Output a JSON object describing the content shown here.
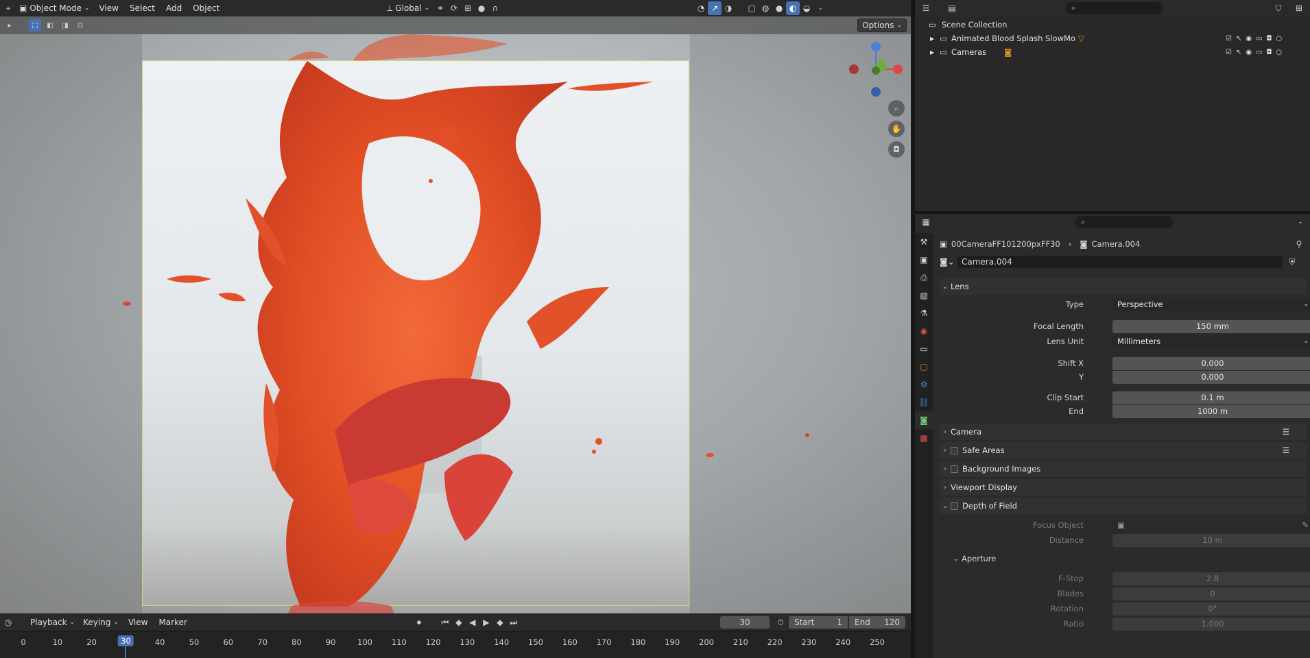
{
  "header": {
    "mode": "Object Mode",
    "menus": [
      "View",
      "Select",
      "Add",
      "Object"
    ],
    "orientation": "Global",
    "options_label": "Options"
  },
  "outliner": {
    "root": "Scene Collection",
    "items": [
      {
        "label": "Animated Blood Splash SlowMo"
      },
      {
        "label": "Cameras"
      }
    ]
  },
  "properties": {
    "breadcrumb_object": "00CameraFF101200pxFF30",
    "breadcrumb_data": "Camera.004",
    "datablock_name": "Camera.004",
    "lens": {
      "title": "Lens",
      "type_label": "Type",
      "type_value": "Perspective",
      "focal_label": "Focal Length",
      "focal_value": "150 mm",
      "lensunit_label": "Lens Unit",
      "lensunit_value": "Millimeters",
      "shiftx_label": "Shift X",
      "shiftx_value": "0.000",
      "shifty_label": "Y",
      "shifty_value": "0.000",
      "clipstart_label": "Clip Start",
      "clipstart_value": "0.1 m",
      "clipend_label": "End",
      "clipend_value": "1000 m"
    },
    "sections": {
      "camera": "Camera",
      "safe": "Safe Areas",
      "bg": "Background Images",
      "vpd": "Viewport Display",
      "dof": "Depth of Field"
    },
    "dof": {
      "focus_label": "Focus Object",
      "distance_label": "Distance",
      "distance_value": "10 m",
      "aperture_title": "Aperture",
      "fstop_label": "F-Stop",
      "fstop_value": "2.8",
      "blades_label": "Blades",
      "blades_value": "0",
      "rotation_label": "Rotation",
      "rotation_value": "0°",
      "ratio_label": "Ratio",
      "ratio_value": "1.000"
    }
  },
  "timeline": {
    "menus": [
      "Playback",
      "Keying",
      "View",
      "Marker"
    ],
    "current_frame": "30",
    "start_label": "Start",
    "start_value": "1",
    "end_label": "End",
    "end_value": "120",
    "ticks": [
      "0",
      "10",
      "20",
      "30",
      "40",
      "50",
      "60",
      "70",
      "80",
      "90",
      "100",
      "110",
      "120",
      "130",
      "140",
      "150",
      "160",
      "170",
      "180",
      "190",
      "200",
      "210",
      "220",
      "230",
      "240",
      "250"
    ]
  },
  "colors": {
    "accent": "#4772b3",
    "splash": "#e8502a",
    "frame": "#d9d36b"
  }
}
